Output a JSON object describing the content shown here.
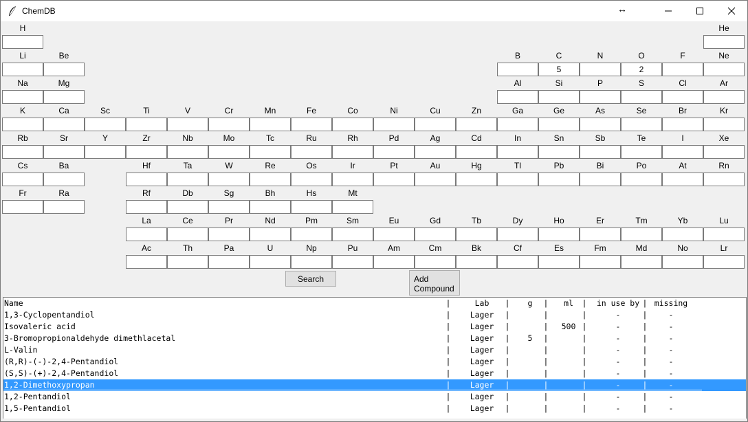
{
  "window": {
    "title": "ChemDB"
  },
  "titlebar_controls": {
    "resize_glyph": "↔"
  },
  "periodic_table": {
    "rows": [
      [
        {
          "sym": "H",
          "col": 0,
          "val": ""
        },
        {
          "sym": "He",
          "col": 17,
          "val": ""
        }
      ],
      [
        {
          "sym": "Li",
          "col": 0,
          "val": ""
        },
        {
          "sym": "Be",
          "col": 1,
          "val": ""
        },
        {
          "sym": "B",
          "col": 12,
          "val": ""
        },
        {
          "sym": "C",
          "col": 13,
          "val": "5"
        },
        {
          "sym": "N",
          "col": 14,
          "val": ""
        },
        {
          "sym": "O",
          "col": 15,
          "val": "2"
        },
        {
          "sym": "F",
          "col": 16,
          "val": ""
        },
        {
          "sym": "Ne",
          "col": 17,
          "val": ""
        }
      ],
      [
        {
          "sym": "Na",
          "col": 0,
          "val": ""
        },
        {
          "sym": "Mg",
          "col": 1,
          "val": ""
        },
        {
          "sym": "Al",
          "col": 12,
          "val": ""
        },
        {
          "sym": "Si",
          "col": 13,
          "val": ""
        },
        {
          "sym": "P",
          "col": 14,
          "val": ""
        },
        {
          "sym": "S",
          "col": 15,
          "val": ""
        },
        {
          "sym": "Cl",
          "col": 16,
          "val": ""
        },
        {
          "sym": "Ar",
          "col": 17,
          "val": ""
        }
      ],
      [
        {
          "sym": "K",
          "col": 0,
          "val": ""
        },
        {
          "sym": "Ca",
          "col": 1,
          "val": ""
        },
        {
          "sym": "Sc",
          "col": 2,
          "val": ""
        },
        {
          "sym": "Ti",
          "col": 3,
          "val": ""
        },
        {
          "sym": "V",
          "col": 4,
          "val": ""
        },
        {
          "sym": "Cr",
          "col": 5,
          "val": ""
        },
        {
          "sym": "Mn",
          "col": 6,
          "val": ""
        },
        {
          "sym": "Fe",
          "col": 7,
          "val": ""
        },
        {
          "sym": "Co",
          "col": 8,
          "val": ""
        },
        {
          "sym": "Ni",
          "col": 9,
          "val": ""
        },
        {
          "sym": "Cu",
          "col": 10,
          "val": ""
        },
        {
          "sym": "Zn",
          "col": 11,
          "val": ""
        },
        {
          "sym": "Ga",
          "col": 12,
          "val": ""
        },
        {
          "sym": "Ge",
          "col": 13,
          "val": ""
        },
        {
          "sym": "As",
          "col": 14,
          "val": ""
        },
        {
          "sym": "Se",
          "col": 15,
          "val": ""
        },
        {
          "sym": "Br",
          "col": 16,
          "val": ""
        },
        {
          "sym": "Kr",
          "col": 17,
          "val": ""
        }
      ],
      [
        {
          "sym": "Rb",
          "col": 0,
          "val": ""
        },
        {
          "sym": "Sr",
          "col": 1,
          "val": ""
        },
        {
          "sym": "Y",
          "col": 2,
          "val": ""
        },
        {
          "sym": "Zr",
          "col": 3,
          "val": ""
        },
        {
          "sym": "Nb",
          "col": 4,
          "val": ""
        },
        {
          "sym": "Mo",
          "col": 5,
          "val": ""
        },
        {
          "sym": "Tc",
          "col": 6,
          "val": ""
        },
        {
          "sym": "Ru",
          "col": 7,
          "val": ""
        },
        {
          "sym": "Rh",
          "col": 8,
          "val": ""
        },
        {
          "sym": "Pd",
          "col": 9,
          "val": ""
        },
        {
          "sym": "Ag",
          "col": 10,
          "val": ""
        },
        {
          "sym": "Cd",
          "col": 11,
          "val": ""
        },
        {
          "sym": "In",
          "col": 12,
          "val": ""
        },
        {
          "sym": "Sn",
          "col": 13,
          "val": ""
        },
        {
          "sym": "Sb",
          "col": 14,
          "val": ""
        },
        {
          "sym": "Te",
          "col": 15,
          "val": ""
        },
        {
          "sym": "I",
          "col": 16,
          "val": ""
        },
        {
          "sym": "Xe",
          "col": 17,
          "val": ""
        }
      ],
      [
        {
          "sym": "Cs",
          "col": 0,
          "val": ""
        },
        {
          "sym": "Ba",
          "col": 1,
          "val": ""
        },
        {
          "sym": "Hf",
          "col": 3,
          "val": ""
        },
        {
          "sym": "Ta",
          "col": 4,
          "val": ""
        },
        {
          "sym": "W",
          "col": 5,
          "val": ""
        },
        {
          "sym": "Re",
          "col": 6,
          "val": ""
        },
        {
          "sym": "Os",
          "col": 7,
          "val": ""
        },
        {
          "sym": "Ir",
          "col": 8,
          "val": ""
        },
        {
          "sym": "Pt",
          "col": 9,
          "val": ""
        },
        {
          "sym": "Au",
          "col": 10,
          "val": ""
        },
        {
          "sym": "Hg",
          "col": 11,
          "val": ""
        },
        {
          "sym": "Tl",
          "col": 12,
          "val": ""
        },
        {
          "sym": "Pb",
          "col": 13,
          "val": ""
        },
        {
          "sym": "Bi",
          "col": 14,
          "val": ""
        },
        {
          "sym": "Po",
          "col": 15,
          "val": ""
        },
        {
          "sym": "At",
          "col": 16,
          "val": ""
        },
        {
          "sym": "Rn",
          "col": 17,
          "val": ""
        }
      ],
      [
        {
          "sym": "Fr",
          "col": 0,
          "val": ""
        },
        {
          "sym": "Ra",
          "col": 1,
          "val": ""
        },
        {
          "sym": "Rf",
          "col": 3,
          "val": ""
        },
        {
          "sym": "Db",
          "col": 4,
          "val": ""
        },
        {
          "sym": "Sg",
          "col": 5,
          "val": ""
        },
        {
          "sym": "Bh",
          "col": 6,
          "val": ""
        },
        {
          "sym": "Hs",
          "col": 7,
          "val": ""
        },
        {
          "sym": "Mt",
          "col": 8,
          "val": ""
        }
      ],
      [
        {
          "sym": "La",
          "col": 3,
          "val": ""
        },
        {
          "sym": "Ce",
          "col": 4,
          "val": ""
        },
        {
          "sym": "Pr",
          "col": 5,
          "val": ""
        },
        {
          "sym": "Nd",
          "col": 6,
          "val": ""
        },
        {
          "sym": "Pm",
          "col": 7,
          "val": ""
        },
        {
          "sym": "Sm",
          "col": 8,
          "val": ""
        },
        {
          "sym": "Eu",
          "col": 9,
          "val": ""
        },
        {
          "sym": "Gd",
          "col": 10,
          "val": ""
        },
        {
          "sym": "Tb",
          "col": 11,
          "val": ""
        },
        {
          "sym": "Dy",
          "col": 12,
          "val": ""
        },
        {
          "sym": "Ho",
          "col": 13,
          "val": ""
        },
        {
          "sym": "Er",
          "col": 14,
          "val": ""
        },
        {
          "sym": "Tm",
          "col": 15,
          "val": ""
        },
        {
          "sym": "Yb",
          "col": 16,
          "val": ""
        },
        {
          "sym": "Lu",
          "col": 17,
          "val": ""
        }
      ],
      [
        {
          "sym": "Ac",
          "col": 3,
          "val": ""
        },
        {
          "sym": "Th",
          "col": 4,
          "val": ""
        },
        {
          "sym": "Pa",
          "col": 5,
          "val": ""
        },
        {
          "sym": "U",
          "col": 6,
          "val": ""
        },
        {
          "sym": "Np",
          "col": 7,
          "val": ""
        },
        {
          "sym": "Pu",
          "col": 8,
          "val": ""
        },
        {
          "sym": "Am",
          "col": 9,
          "val": ""
        },
        {
          "sym": "Cm",
          "col": 10,
          "val": ""
        },
        {
          "sym": "Bk",
          "col": 11,
          "val": ""
        },
        {
          "sym": "Cf",
          "col": 12,
          "val": ""
        },
        {
          "sym": "Es",
          "col": 13,
          "val": ""
        },
        {
          "sym": "Fm",
          "col": 14,
          "val": ""
        },
        {
          "sym": "Md",
          "col": 15,
          "val": ""
        },
        {
          "sym": "No",
          "col": 16,
          "val": ""
        },
        {
          "sym": "Lr",
          "col": 17,
          "val": ""
        }
      ]
    ]
  },
  "buttons": {
    "search_label": "Search",
    "add_compound_line1": "Add",
    "add_compound_line2": "Compound"
  },
  "list": {
    "headers": [
      "Name",
      "Lab",
      "g",
      "ml",
      "in use by",
      "missing"
    ],
    "separator": "|",
    "rows": [
      {
        "name": "1,3-Cyclopentandiol",
        "lab": "Lager",
        "g": "",
        "ml": "",
        "in_use_by": "-",
        "missing": "-"
      },
      {
        "name": "Isovaleric acid",
        "lab": "Lager",
        "g": "",
        "ml": "500",
        "in_use_by": "-",
        "missing": "-"
      },
      {
        "name": "3-Bromopropionaldehyde dimethlacetal",
        "lab": "Lager",
        "g": "5",
        "ml": "",
        "in_use_by": "-",
        "missing": "-"
      },
      {
        "name": "L-Valin",
        "lab": "Lager",
        "g": "",
        "ml": "",
        "in_use_by": "-",
        "missing": "-"
      },
      {
        "name": "(R,R)-(-)-2,4-Pentandiol",
        "lab": "Lager",
        "g": "",
        "ml": "",
        "in_use_by": "-",
        "missing": "-"
      },
      {
        "name": "(S,S)-(+)-2,4-Pentandiol",
        "lab": "Lager",
        "g": "",
        "ml": "",
        "in_use_by": "-",
        "missing": "-"
      },
      {
        "name": "1,2-Dimethoxypropan",
        "lab": "Lager",
        "g": "",
        "ml": "",
        "in_use_by": "-",
        "missing": "-",
        "selected": true
      },
      {
        "name": "1,2-Pentandiol",
        "lab": "Lager",
        "g": "",
        "ml": "",
        "in_use_by": "-",
        "missing": "-"
      },
      {
        "name": "1,5-Pentandiol",
        "lab": "Lager",
        "g": "",
        "ml": "",
        "in_use_by": "-",
        "missing": "-"
      }
    ]
  },
  "colors": {
    "selection": "#3399ff",
    "window_bg": "#f0f0f0"
  }
}
